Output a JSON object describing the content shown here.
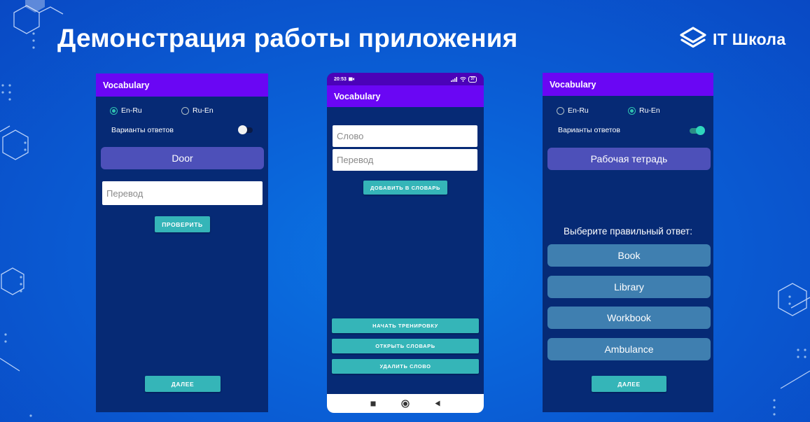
{
  "slide": {
    "title": "Демонстрация работы приложения",
    "brand": "IT Школа",
    "logo_icon": "layers-icon"
  },
  "screen1": {
    "appbar": "Vocabulary",
    "radio_en_ru": "En-Ru",
    "radio_ru_en": "Ru-En",
    "selected_mode": "En-Ru",
    "options_label": "Варианты ответов",
    "options_enabled": false,
    "word": "Door",
    "translation_placeholder": "Перевод",
    "check_button": "ПРОВЕРИТЬ",
    "next_button": "ДАЛЕЕ"
  },
  "screen2": {
    "status_time": "20:53",
    "battery": "37",
    "appbar": "Vocabulary",
    "word_placeholder": "Слово",
    "translation_placeholder": "Перевод",
    "add_button": "ДОБАВИТЬ В СЛОВАРЬ",
    "start_training_button": "НАЧАТЬ ТРЕНИРОВКУ",
    "open_dictionary_button": "ОТКРЫТЬ СЛОВАРЬ",
    "delete_word_button": "УДАЛИТЬ СЛОВО",
    "nav_icons": [
      "square-icon",
      "circle-icon",
      "back-triangle-icon"
    ]
  },
  "screen3": {
    "appbar": "Vocabulary",
    "radio_en_ru": "En-Ru",
    "radio_ru_en": "Ru-En",
    "selected_mode": "Ru-En",
    "options_label": "Варианты ответов",
    "options_enabled": true,
    "word": "Рабочая тетрадь",
    "prompt": "Выберите правильный ответ:",
    "answers": [
      "Book",
      "Library",
      "Workbook",
      "Ambulance"
    ],
    "next_button": "ДАЛЕЕ"
  },
  "colors": {
    "background": "#0a5fd6",
    "app_background": "#062a75",
    "appbar": "#6a06f4",
    "accent_teal": "#35b5b8",
    "word_card": "#4d50b9",
    "answer_button": "#3f7fb0"
  }
}
